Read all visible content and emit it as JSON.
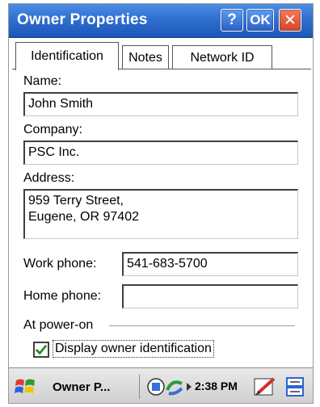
{
  "window": {
    "title": "Owner Properties",
    "help_label": "?",
    "ok_label": "OK",
    "close_label": "✕"
  },
  "tabs": [
    {
      "label": "Identification",
      "active": true
    },
    {
      "label": "Notes",
      "active": false
    },
    {
      "label": "Network ID",
      "active": false
    }
  ],
  "form": {
    "name_label": "Name:",
    "name_value": "John Smith",
    "company_label": "Company:",
    "company_value": "PSC Inc.",
    "address_label": "Address:",
    "address_value": "959 Terry Street,\nEugene, OR 97402",
    "work_phone_label": "Work phone:",
    "work_phone_value": "541-683-5700",
    "home_phone_label": "Home phone:",
    "home_phone_value": "",
    "power_group_label": "At power-on",
    "display_owner_label": "Display owner identification",
    "display_owner_checked": true
  },
  "taskbar": {
    "app_label": "Owner P...",
    "clock": "2:38 PM",
    "start_icon": "windows-flag-icon",
    "tray_icons": [
      "network-icon",
      "sync-icon",
      "edit-icon",
      "keyboard-icon"
    ]
  },
  "colors": {
    "titlebar": "#2f6fd0",
    "close_button": "#d6452a",
    "check": "#1e8a1e"
  }
}
